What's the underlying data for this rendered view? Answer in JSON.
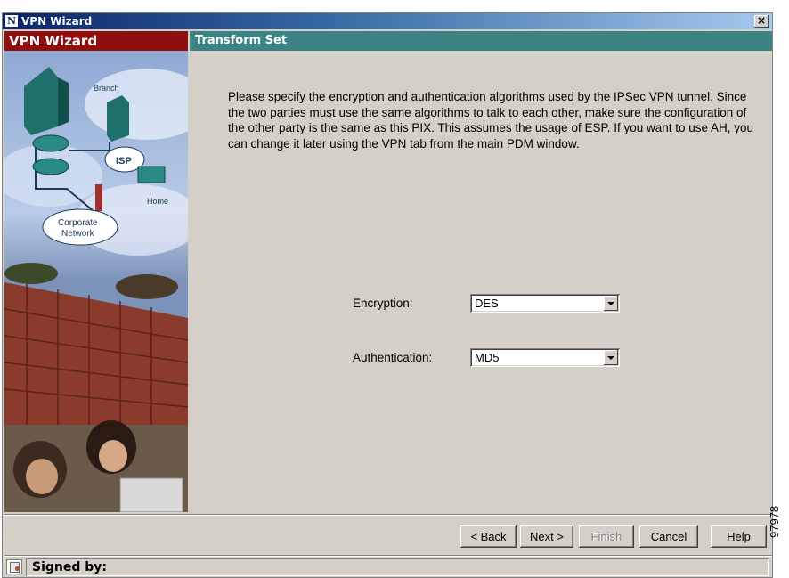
{
  "window": {
    "title": "VPN Wizard",
    "close_glyph": "×",
    "app_icon_letter": "N"
  },
  "sidebar": {
    "header": "VPN Wizard",
    "illustration": {
      "labels": [
        "Branch",
        "ISP",
        "Home",
        "Corporate",
        "Network"
      ]
    }
  },
  "main": {
    "header": "Transform Set",
    "description": "Please specify the encryption and authentication algorithms used by the IPSec VPN tunnel.  Since the two parties must use the same algorithms to talk to each other, make sure the configuration of the other party is the same as this PIX. This assumes the usage of ESP.  If you want to use AH, you can change it later using the VPN tab from the main PDM window."
  },
  "form": {
    "encryption": {
      "label": "Encryption:",
      "value": "DES"
    },
    "authentication": {
      "label": "Authentication:",
      "value": "MD5"
    }
  },
  "buttons": {
    "back": "< Back",
    "next": "Next >",
    "finish": "Finish",
    "cancel": "Cancel",
    "help": "Help"
  },
  "status": {
    "signed_by": "Signed by:"
  },
  "figure_id": "97978",
  "colors": {
    "sidebar_header": "#8f0e0e",
    "main_header": "#3c8384",
    "titlebar": "#0a246a",
    "dialog_bg": "#d4d0c8"
  },
  "icons": [
    "app-icon",
    "close-icon",
    "combo-arrow-icon",
    "certificate-icon"
  ]
}
